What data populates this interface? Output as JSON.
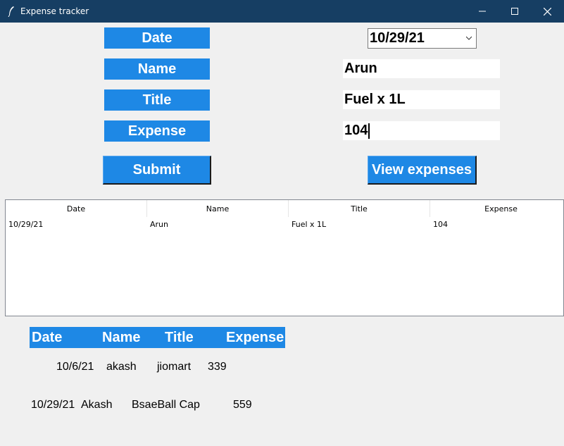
{
  "window": {
    "title": "Expense tracker"
  },
  "form": {
    "date_label": "Date",
    "name_label": "Name",
    "title_label": "Title",
    "expense_label": "Expense",
    "date_value": "10/29/21",
    "name_value": "Arun",
    "title_value": "Fuel x 1L",
    "expense_value": "104",
    "submit_label": "Submit",
    "view_label": "View expenses"
  },
  "table": {
    "columns": [
      "Date",
      "Name",
      "Title",
      "Expense"
    ],
    "rows": [
      [
        "10/29/21",
        "Arun",
        "Fuel x 1L",
        "104"
      ]
    ]
  },
  "history": {
    "headers": [
      "Date",
      "Name",
      "Title",
      "Expense"
    ],
    "rows": [
      [
        "10/6/21",
        "akash",
        "jiomart",
        "339"
      ],
      [
        "10/29/21",
        "Akash",
        "BsaeBall Cap",
        "559"
      ]
    ]
  },
  "colors": {
    "accent": "#1e88e5",
    "titlebar": "#163e63",
    "background": "#f0f0f0"
  },
  "icons": [
    "feather-icon",
    "minimize-icon",
    "maximize-icon",
    "close-icon",
    "chevron-down-icon"
  ]
}
